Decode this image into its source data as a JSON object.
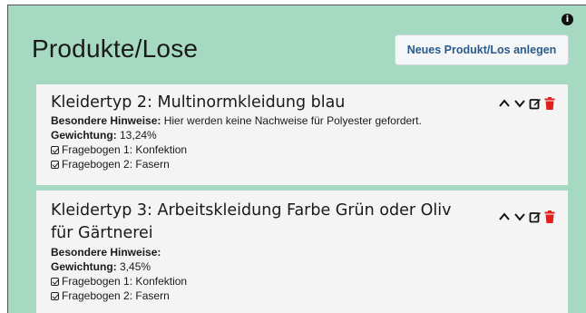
{
  "page": {
    "title": "Produkte/Lose"
  },
  "toolbar": {
    "new_label": "Neues Produkt/Los anlegen"
  },
  "products": [
    {
      "title": "Kleidertyp 2: Multinormkleidung blau",
      "notes_label": "Besondere Hinweise:",
      "notes_value": " Hier werden keine Nachweise für Polyester gefordert.",
      "weight_label": "Gewichtung:",
      "weight_value": " 13,24%",
      "questionnaires": [
        "Fragebogen 1: Konfektion",
        "Fragebogen 2: Fasern"
      ]
    },
    {
      "title": "Kleidertyp 3: Arbeitskleidung Farbe Grün oder Oliv für Gärtnerei",
      "notes_label": "Besondere Hinweise:",
      "notes_value": "",
      "weight_label": "Gewichtung:",
      "weight_value": " 3,45%",
      "questionnaires": [
        "Fragebogen 1: Konfektion",
        "Fragebogen 2: Fasern"
      ]
    }
  ],
  "icons": {
    "info": "info-icon",
    "up": "chevron-up-icon",
    "down": "chevron-down-icon",
    "edit": "edit-icon",
    "delete": "trash-icon"
  },
  "colors": {
    "background": "#a5d9c2",
    "card": "#f4f4f4",
    "button_text": "#2a5a8a",
    "delete": "#e0211d"
  }
}
